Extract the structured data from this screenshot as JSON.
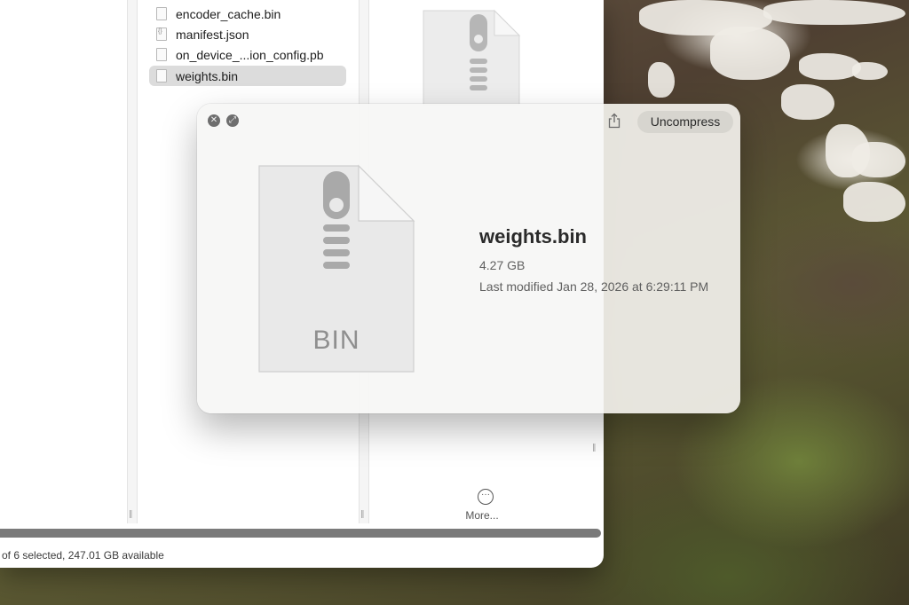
{
  "finder": {
    "files": [
      {
        "name": "encoder_cache.bin",
        "icon": "document-icon",
        "selected": false
      },
      {
        "name": "manifest.json",
        "icon": "json-document-icon",
        "selected": false
      },
      {
        "name": "on_device_...ion_config.pb",
        "icon": "document-icon",
        "selected": false
      },
      {
        "name": "weights.bin",
        "icon": "document-icon",
        "selected": true
      }
    ],
    "more_label": "More...",
    "more_icon": "ellipsis-circle-icon",
    "status_text": "of 6 selected, 247.01 GB available"
  },
  "quicklook": {
    "close_icon": "close-icon",
    "fullscreen_icon": "fullscreen-icon",
    "share_icon": "share-icon",
    "action_label": "Uncompress",
    "file_icon_label": "BIN",
    "file_name": "weights.bin",
    "file_size": "4.27 GB",
    "modified": "Last modified Jan 28, 2026 at 6:29:11 PM"
  },
  "colors": {
    "selection": "#dcdcdc",
    "panel": "#f6f6f5",
    "text_primary": "#2a2a2a",
    "text_secondary": "#5f5f5f"
  }
}
